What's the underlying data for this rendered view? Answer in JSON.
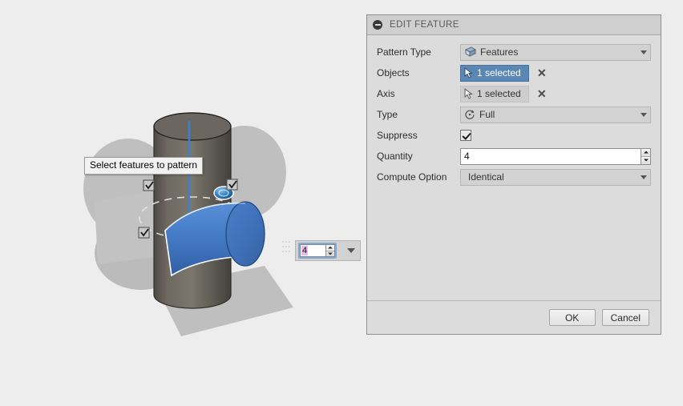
{
  "viewport": {
    "tooltip": "Select features to pattern",
    "colors": {
      "background": "#ededed",
      "body_cylinder": "#6b6760",
      "selected_feature": "#3f74bd",
      "ghost_preview": "#a9a9a9",
      "axis_line": "#3f7fc4",
      "ground_plane": "#bdbdbd"
    },
    "floating_spinner": {
      "name": "quantity-spinner-overlay",
      "value": "4",
      "selected": true
    },
    "instance_markers": 3
  },
  "dialog": {
    "title": "EDIT FEATURE",
    "collapse_icon": "minus-circle-icon",
    "rows": [
      {
        "label": "Pattern Type",
        "kind": "combo",
        "icon": "solid-body-icon",
        "value": "Features"
      },
      {
        "label": "Objects",
        "kind": "select",
        "icon": "cursor-arrow-icon",
        "value": "1 selected",
        "active": true,
        "clear": "✕"
      },
      {
        "label": "Axis",
        "kind": "select",
        "icon": "cursor-arrow-icon",
        "value": "1 selected",
        "active": false,
        "clear": "✕"
      },
      {
        "label": "Type",
        "kind": "combo",
        "icon": "circular-pattern-icon",
        "value": "Full"
      },
      {
        "label": "Suppress",
        "kind": "checkbox",
        "checked": true
      },
      {
        "label": "Quantity",
        "kind": "number",
        "value": "4"
      },
      {
        "label": "Compute Option",
        "kind": "combo",
        "icon": "",
        "value": "Identical"
      }
    ],
    "footer": {
      "ok_label": "OK",
      "cancel_label": "Cancel"
    }
  }
}
